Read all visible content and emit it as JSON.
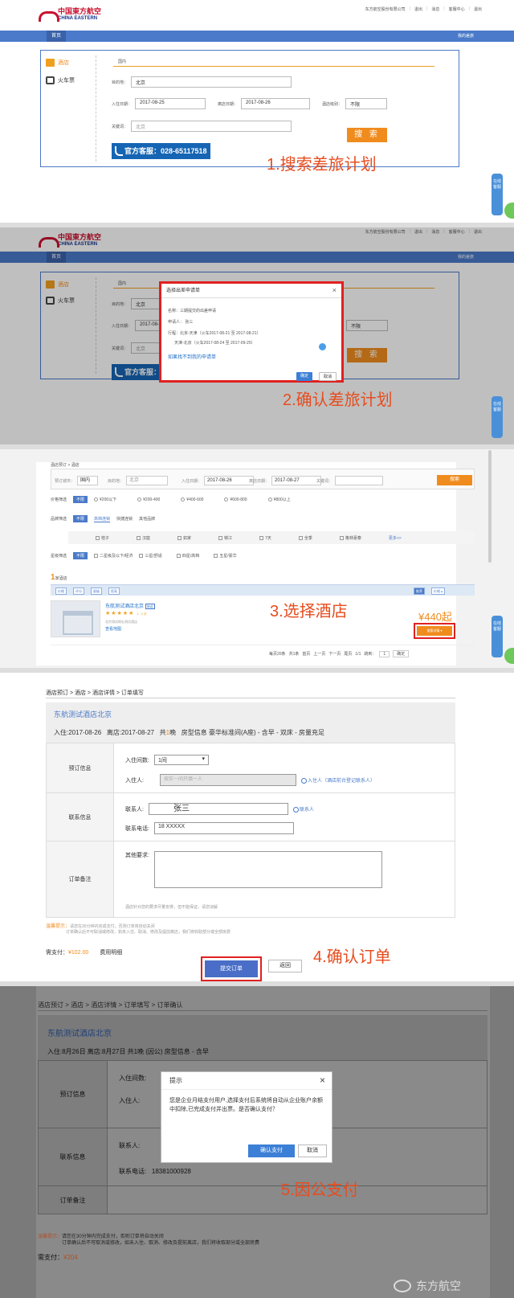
{
  "chrome": {
    "logo_cn": "中国東方航空",
    "logo_en": "CHINA EASTERN",
    "top_links": [
      "东方航空股份有限公司",
      "退出",
      "消息",
      "客服中心",
      "退出"
    ],
    "nav_home": "首页",
    "nav_right": "我的差旅"
  },
  "step1": {
    "tab_hotel": "酒店",
    "tab_train": "火车票",
    "domestic_tab": "国内",
    "dest_label": "目的地：",
    "dest_value": "北京",
    "checkin_label": "入住日期：",
    "checkin_value": "2017-08-25",
    "checkout_label": "离店日期：",
    "checkout_value": "2017-08-26",
    "star_label": "酒店级别：",
    "star_value": "不限",
    "keyword_label": "关键词：",
    "keyword_value": "北京",
    "search_btn": "搜 索",
    "service": "官方客服：028-65117518",
    "label": "1.搜索差旅计划",
    "float": "在线客服"
  },
  "step2": {
    "modal_title": "选择出差申请单",
    "line1": "名称：三期提交的出差申请",
    "line2": "申请人：    张三",
    "line3": "行程：北京-天津（火车2017-08-21 至 2017-08-21）",
    "line4": "天津-北京（火车2017-08-24 至 2017-09-25）",
    "link": "如果找不到我的申请单",
    "confirm": "确定",
    "cancel": "取消",
    "label": "2.确认差旅计划"
  },
  "step3": {
    "crumb": "酒店预订 > 酒店",
    "f_city_label": "预订城市：",
    "f_city_value": "国内",
    "f_dest_label": "目的地：",
    "f_dest_value": "北京",
    "f_in_label": "入住日期：",
    "f_in_value": "2017-08-26",
    "f_out_label": "离店日期：",
    "f_out_value": "2017-08-27",
    "f_kw_label": "关键词：",
    "search_btn": "搜索",
    "price_label": "价格筛选",
    "price_opts": [
      "¥200以下",
      "¥200-400",
      "¥400-600",
      "¥600-800",
      "¥800以上"
    ],
    "brand_label": "品牌筛选",
    "brand_tabs": [
      "高档连锁",
      "快捷连锁",
      "其他品牌"
    ],
    "brand_opts": [
      "桔子",
      "汉庭",
      "如家",
      "锦江",
      "7天",
      "全季",
      "格林豪泰"
    ],
    "more": "更多>>",
    "star_label": "星级筛选",
    "star_opts": [
      "二星级及以下/经济",
      "三星/舒适",
      "四星/高档",
      "五星/豪华"
    ],
    "unlimited": "不限",
    "count_num": "1",
    "count_text": "家酒店",
    "sort_btns": [
      "价格",
      "评分",
      "星级",
      "距离"
    ],
    "sort_right": [
      "推荐",
      "价格 ▴"
    ],
    "hotel_name": "东航测试酒店北京",
    "hotel_tag": "协议",
    "hotel_stars": "★★★★★",
    "hotel_score": "1.0分",
    "hotel_addr": "北京测试地址测试酒店",
    "hotel_link": "查看地图",
    "price": "¥440起",
    "detail_btn": "查看详情 ▾",
    "pager": [
      "每页20条",
      "共1条",
      "首页",
      "上一页",
      "下一页",
      "尾页",
      "1/1",
      "跳到：",
      "1",
      "确定"
    ],
    "label": "3.选择酒店"
  },
  "step4": {
    "crumb": "酒店预订 > 酒店 > 酒店详情 > 订单填写",
    "hotel_title": "东航测试酒店北京",
    "info_in": "入住:2017-08-26",
    "info_out": "离店:2017-08-27",
    "info_total_pre": "共",
    "info_total_num": "1",
    "info_total_post": "晚",
    "info_room": "房型信息 豪华标准间(A座) - 含早 - 双床 - 房量充足",
    "sec_book": "预订信息",
    "rooms_label": "入住间数:",
    "rooms_value": "1间",
    "guest_label": "入住人:",
    "guest_placeholder": "按实一间只填一人",
    "guest_link": "入住人（酒店前台登记联系人）",
    "sec_contact": "联系信息",
    "contact_label": "联系人:",
    "contact_value": "张三",
    "contact_link": "联系人",
    "phone_label": "联系电话:",
    "phone_value": "18 XXXXX",
    "sec_note": "订单备注",
    "other_label": "其他要求:",
    "other_hint": "酒店针对您的要求尽量安排，但不能保证，请您谅解",
    "notice_title": "温馨提示：",
    "notice1": "请您在30分钟内完成支付，否则订单将自动关闭",
    "notice2": "订单确认后不可取消或修改，如未入住、取消、修改及提前离店，我们将收取部分或全部房费",
    "pay_label": "需支付：",
    "pay_value": "¥102.00",
    "pay_detail": "费用明细",
    "submit": "提交订单",
    "back": "返回",
    "label": "4.确认订单"
  },
  "step5": {
    "crumb": "酒店预订 > 酒店 > 酒店详情 > 订单填写 > 订单确认",
    "hotel_title": "东航测试酒店北京",
    "info": "入住:8月26日   离店:8月27日   共1晚 (因公)   房型信息 - 含早",
    "sec_book": "预订信息",
    "rooms_label": "入住间数:",
    "guest_label": "入住人:",
    "sec_contact": "联系信息",
    "contact_label": "联系人:",
    "phone_label": "联系电话:",
    "phone_value": "18381000928",
    "sec_note": "订单备注",
    "notice_title": "温馨提示：",
    "notice1": "请您在30分钟内完成支付，否则订单将自动关闭",
    "notice2": "订单确认后不可取消或修改，如未入住、取消、修改及提前离店，我们将收取部分或全部房费",
    "pay_label": "需支付：",
    "pay_value": "¥204",
    "modal_title": "提示",
    "modal_msg": "您是企业月结支付用户,选择支付后系统将自动从企业账户余额中扣除,已完成支付并出票。是否确认支付？",
    "confirm": "确认支付",
    "cancel": "取消",
    "label": "5.因公支付",
    "watermark": "东方航空"
  },
  "colors": {
    "accent_blue": "#4a7ac9",
    "orange": "#f08c1e",
    "highlight_red": "#e02020",
    "step_red": "#e74c1e"
  }
}
